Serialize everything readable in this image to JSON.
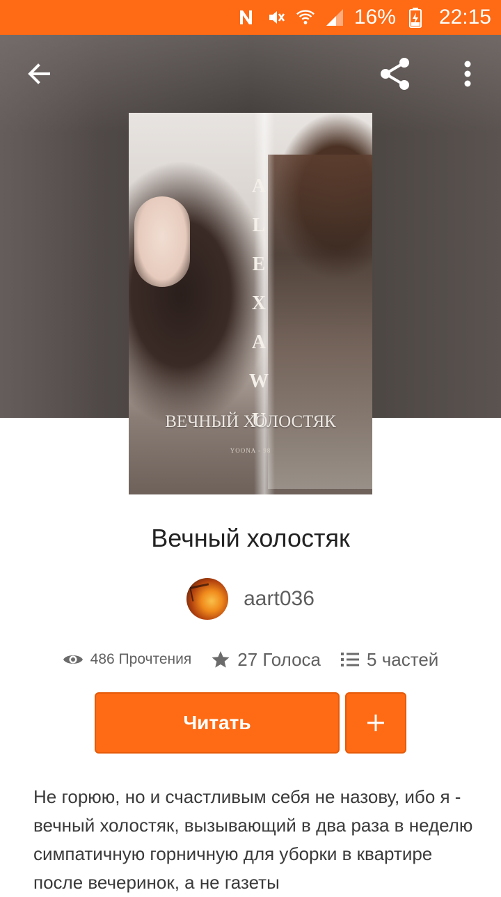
{
  "status_bar": {
    "battery_percent": "16%",
    "time": "22:15",
    "icons": [
      "nfc-icon",
      "mute-icon",
      "wifi-icon",
      "signal-icon",
      "battery-charging-icon"
    ]
  },
  "toolbar": {
    "icons": [
      "back-arrow-icon",
      "share-icon",
      "more-vertical-icon"
    ]
  },
  "cover": {
    "author_text": "ALEXA WU",
    "title_text": "ВЕЧНЫЙ ХОЛОСТЯК",
    "credit_text": "YOONA - 98"
  },
  "story": {
    "title": "Вечный холостяк",
    "author": "aart036"
  },
  "stats": {
    "reads": "486 Прочтения",
    "votes": "27 Голоса",
    "parts": "5 частей"
  },
  "actions": {
    "read_label": "Читать",
    "add_icon": "plus-icon"
  },
  "description": "Не горюю, но и счастливым себя не назову, ибо я - вечный холостяк, вызывающий в два раза в неделю симпатичную горничную для уборки в квартире после вечеринок, а не газеты",
  "colors": {
    "accent": "#ff6a14",
    "text_primary": "#222222",
    "text_secondary": "#616161"
  }
}
